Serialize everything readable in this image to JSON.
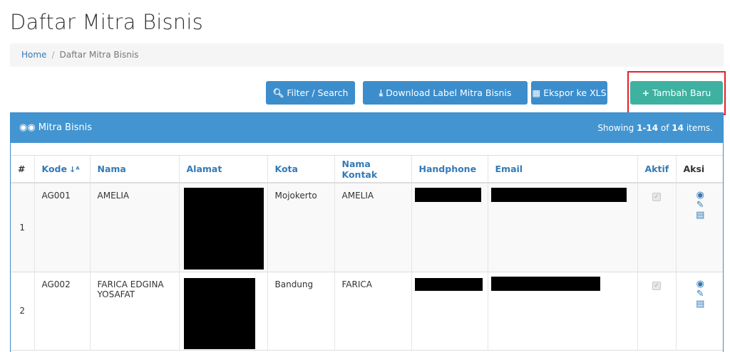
{
  "page": {
    "title": "Daftar Mitra Bisnis"
  },
  "breadcrumb": {
    "home": "Home",
    "separator": "/",
    "current": "Daftar Mitra Bisnis"
  },
  "toolbar": {
    "filter_label": "Filter / Search",
    "download_label": "Download Label Mitra Bisnis",
    "export_label": "Ekspor ke XLS",
    "add_label": "Tambah Baru"
  },
  "panel": {
    "title": "Mitra Bisnis",
    "summary_prefix": "Showing ",
    "summary_range": "1-14",
    "summary_of": " of ",
    "summary_total": "14",
    "summary_suffix": " items."
  },
  "table": {
    "headers": {
      "num": "#",
      "kode": "Kode",
      "nama": "Nama",
      "alamat": "Alamat",
      "kota": "Kota",
      "kontak": "Nama Kontak",
      "hp": "Handphone",
      "email": "Email",
      "aktif": "Aktif",
      "aksi": "Aksi"
    },
    "rows": [
      {
        "num": "1",
        "kode": "AG001",
        "nama": "AMELIA",
        "kota": "Mojokerto",
        "kontak": "AMELIA",
        "aktif": true
      },
      {
        "num": "2",
        "kode": "AG002",
        "nama": "FARICA EDGINA YOSAFAT",
        "kota": "Bandung",
        "kontak": "FARICA",
        "aktif": true
      }
    ]
  },
  "colors": {
    "primary": "#3c8dcc",
    "teal": "#3fb1a0",
    "highlight": "#e4202a",
    "link": "#337ab7"
  }
}
